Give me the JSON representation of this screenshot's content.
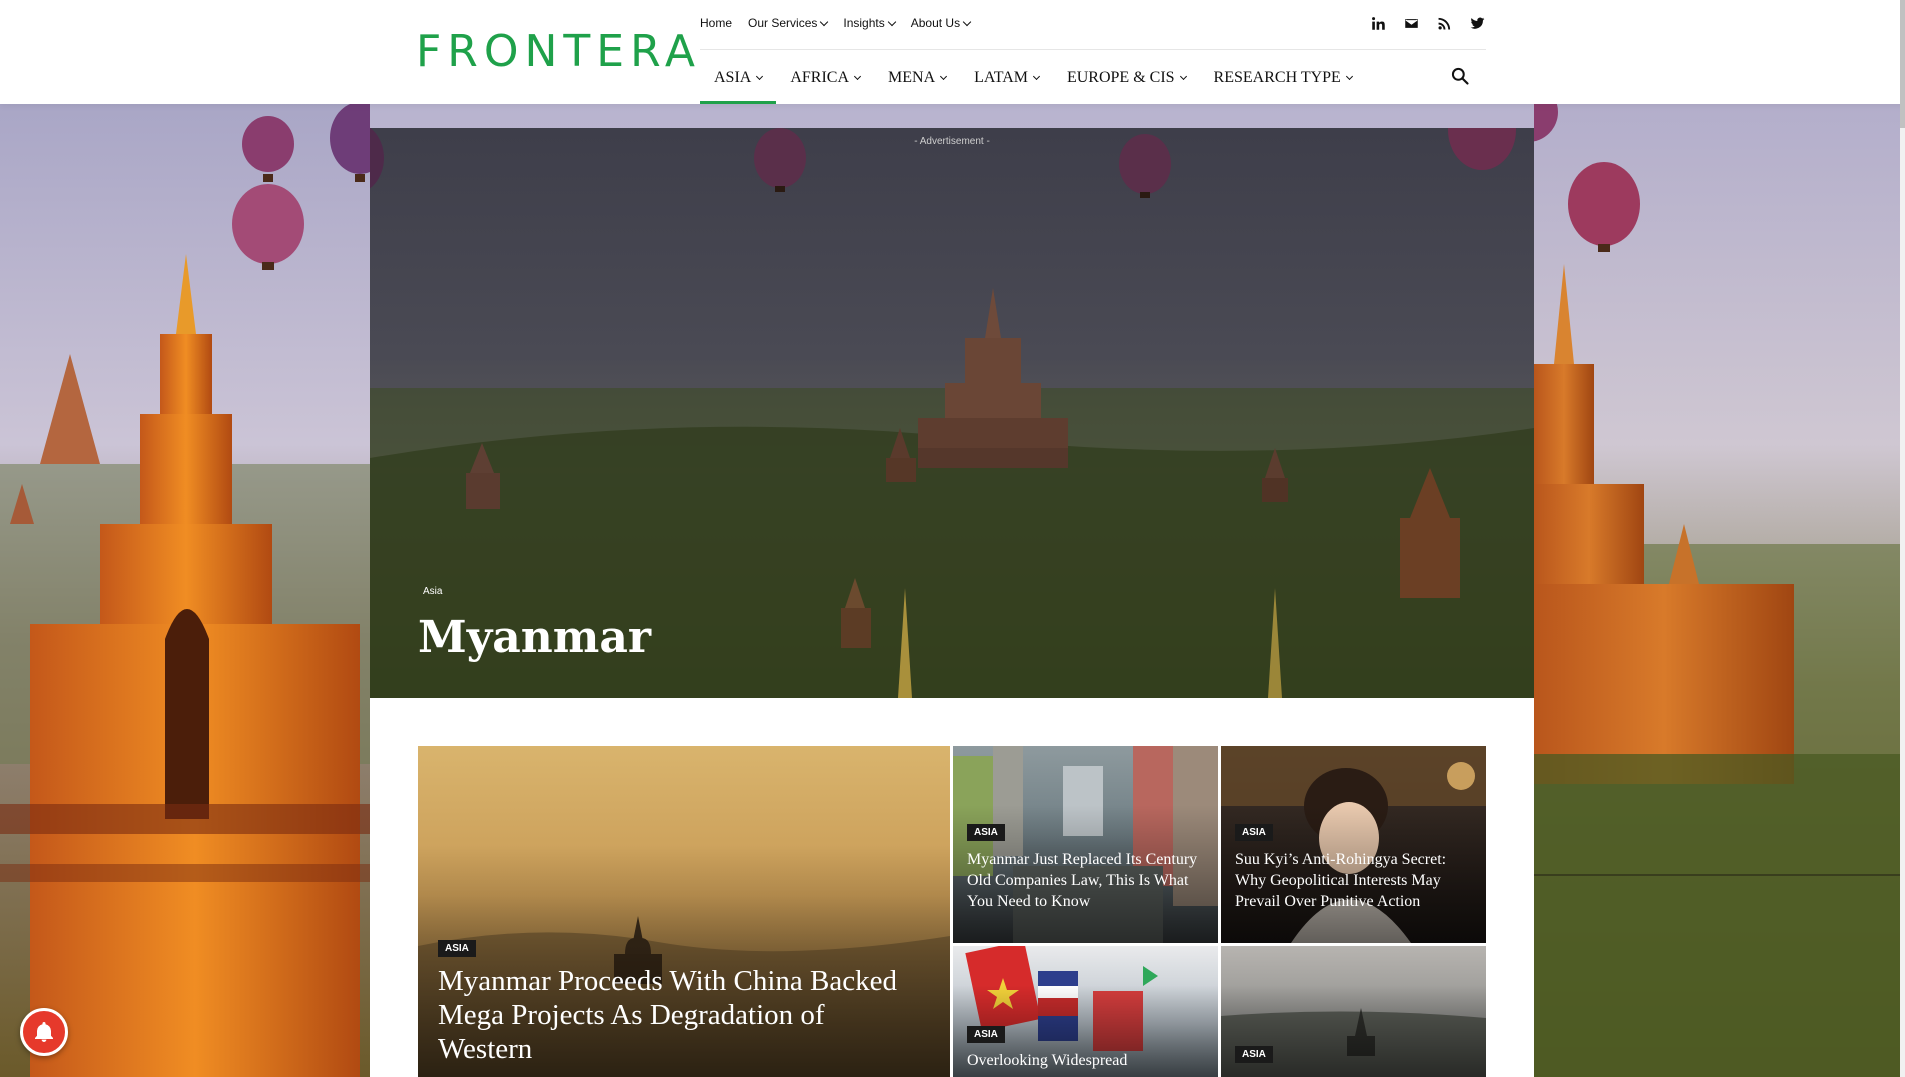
{
  "brand": {
    "logo_text": "FRONTERA",
    "accent_color": "#1fa14a"
  },
  "top_menu": [
    {
      "label": "Home",
      "has_dropdown": false
    },
    {
      "label": "Our Services",
      "has_dropdown": true
    },
    {
      "label": "Insights",
      "has_dropdown": true
    },
    {
      "label": "About Us",
      "has_dropdown": true
    }
  ],
  "social_icons": [
    "linkedin-icon",
    "mail-icon",
    "rss-icon",
    "twitter-icon"
  ],
  "main_nav": [
    {
      "label": "ASIA",
      "active": true
    },
    {
      "label": "AFRICA",
      "active": false
    },
    {
      "label": "MENA",
      "active": false
    },
    {
      "label": "LATAM",
      "active": false
    },
    {
      "label": "EUROPE & CIS",
      "active": false
    },
    {
      "label": "RESEARCH TYPE",
      "active": false
    }
  ],
  "hero": {
    "ad_label": "- Advertisement -",
    "category": "Asia",
    "title": "Myanmar"
  },
  "articles": [
    {
      "tag": "ASIA",
      "title": "Myanmar Proceeds With China Backed Mega Projects As Degradation of Western"
    },
    {
      "tag": "ASIA",
      "title": "Myanmar Just Replaced Its Century Old Companies Law, This Is What You Need to Know"
    },
    {
      "tag": "ASIA",
      "title": "Suu Kyi’s Anti-Rohingya Secret: Why Geopolitical Interests May Prevail Over Punitive Action"
    },
    {
      "tag": "ASIA",
      "title": "Overlooking Widespread"
    },
    {
      "tag": "ASIA",
      "title": ""
    }
  ]
}
